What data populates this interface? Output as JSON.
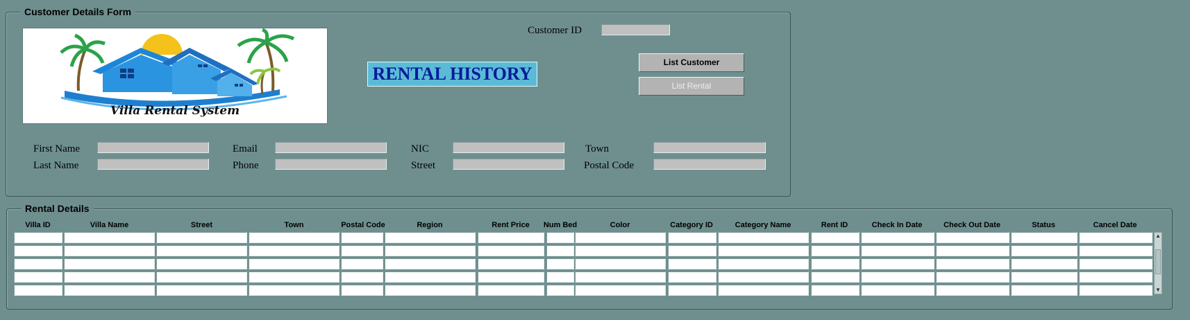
{
  "customer_group": {
    "title": "Customer Details Form"
  },
  "logo": {
    "text": "Villa Rental System"
  },
  "header": {
    "title": "RENTAL HISTORY"
  },
  "customer_id": {
    "label": "Customer ID",
    "value": ""
  },
  "buttons": {
    "list_customer": "List Customer",
    "list_rental": "List Rental"
  },
  "fields": {
    "first_name": {
      "label": "First Name",
      "value": ""
    },
    "last_name": {
      "label": "Last Name",
      "value": ""
    },
    "email": {
      "label": "Email",
      "value": ""
    },
    "phone": {
      "label": "Phone",
      "value": ""
    },
    "nic": {
      "label": "NIC",
      "value": ""
    },
    "street": {
      "label": "Street",
      "value": ""
    },
    "town": {
      "label": "Town",
      "value": ""
    },
    "postal_code": {
      "label": "Postal Code",
      "value": ""
    }
  },
  "rental_group": {
    "title": "Rental Details",
    "columns": [
      "Villa ID",
      "Villa Name",
      "Street",
      "Town",
      "Postal Code",
      "Region",
      "Rent Price",
      "Num Bed",
      "Color",
      "Category ID",
      "Category Name",
      "Rent ID",
      "Check In Date",
      "Check Out Date",
      "Status",
      "Cancel Date"
    ],
    "rows": [
      [
        "",
        "",
        "",
        "",
        "",
        "",
        "",
        "",
        "",
        "",
        "",
        "",
        "",
        "",
        "",
        ""
      ],
      [
        "",
        "",
        "",
        "",
        "",
        "",
        "",
        "",
        "",
        "",
        "",
        "",
        "",
        "",
        "",
        ""
      ],
      [
        "",
        "",
        "",
        "",
        "",
        "",
        "",
        "",
        "",
        "",
        "",
        "",
        "",
        "",
        "",
        ""
      ],
      [
        "",
        "",
        "",
        "",
        "",
        "",
        "",
        "",
        "",
        "",
        "",
        "",
        "",
        "",
        "",
        ""
      ],
      [
        "",
        "",
        "",
        "",
        "",
        "",
        "",
        "",
        "",
        "",
        "",
        "",
        "",
        "",
        "",
        ""
      ]
    ]
  },
  "colors": {
    "background": "#6f8f8f",
    "title_bg": "#5bbbd7",
    "title_text": "#061a9a"
  }
}
